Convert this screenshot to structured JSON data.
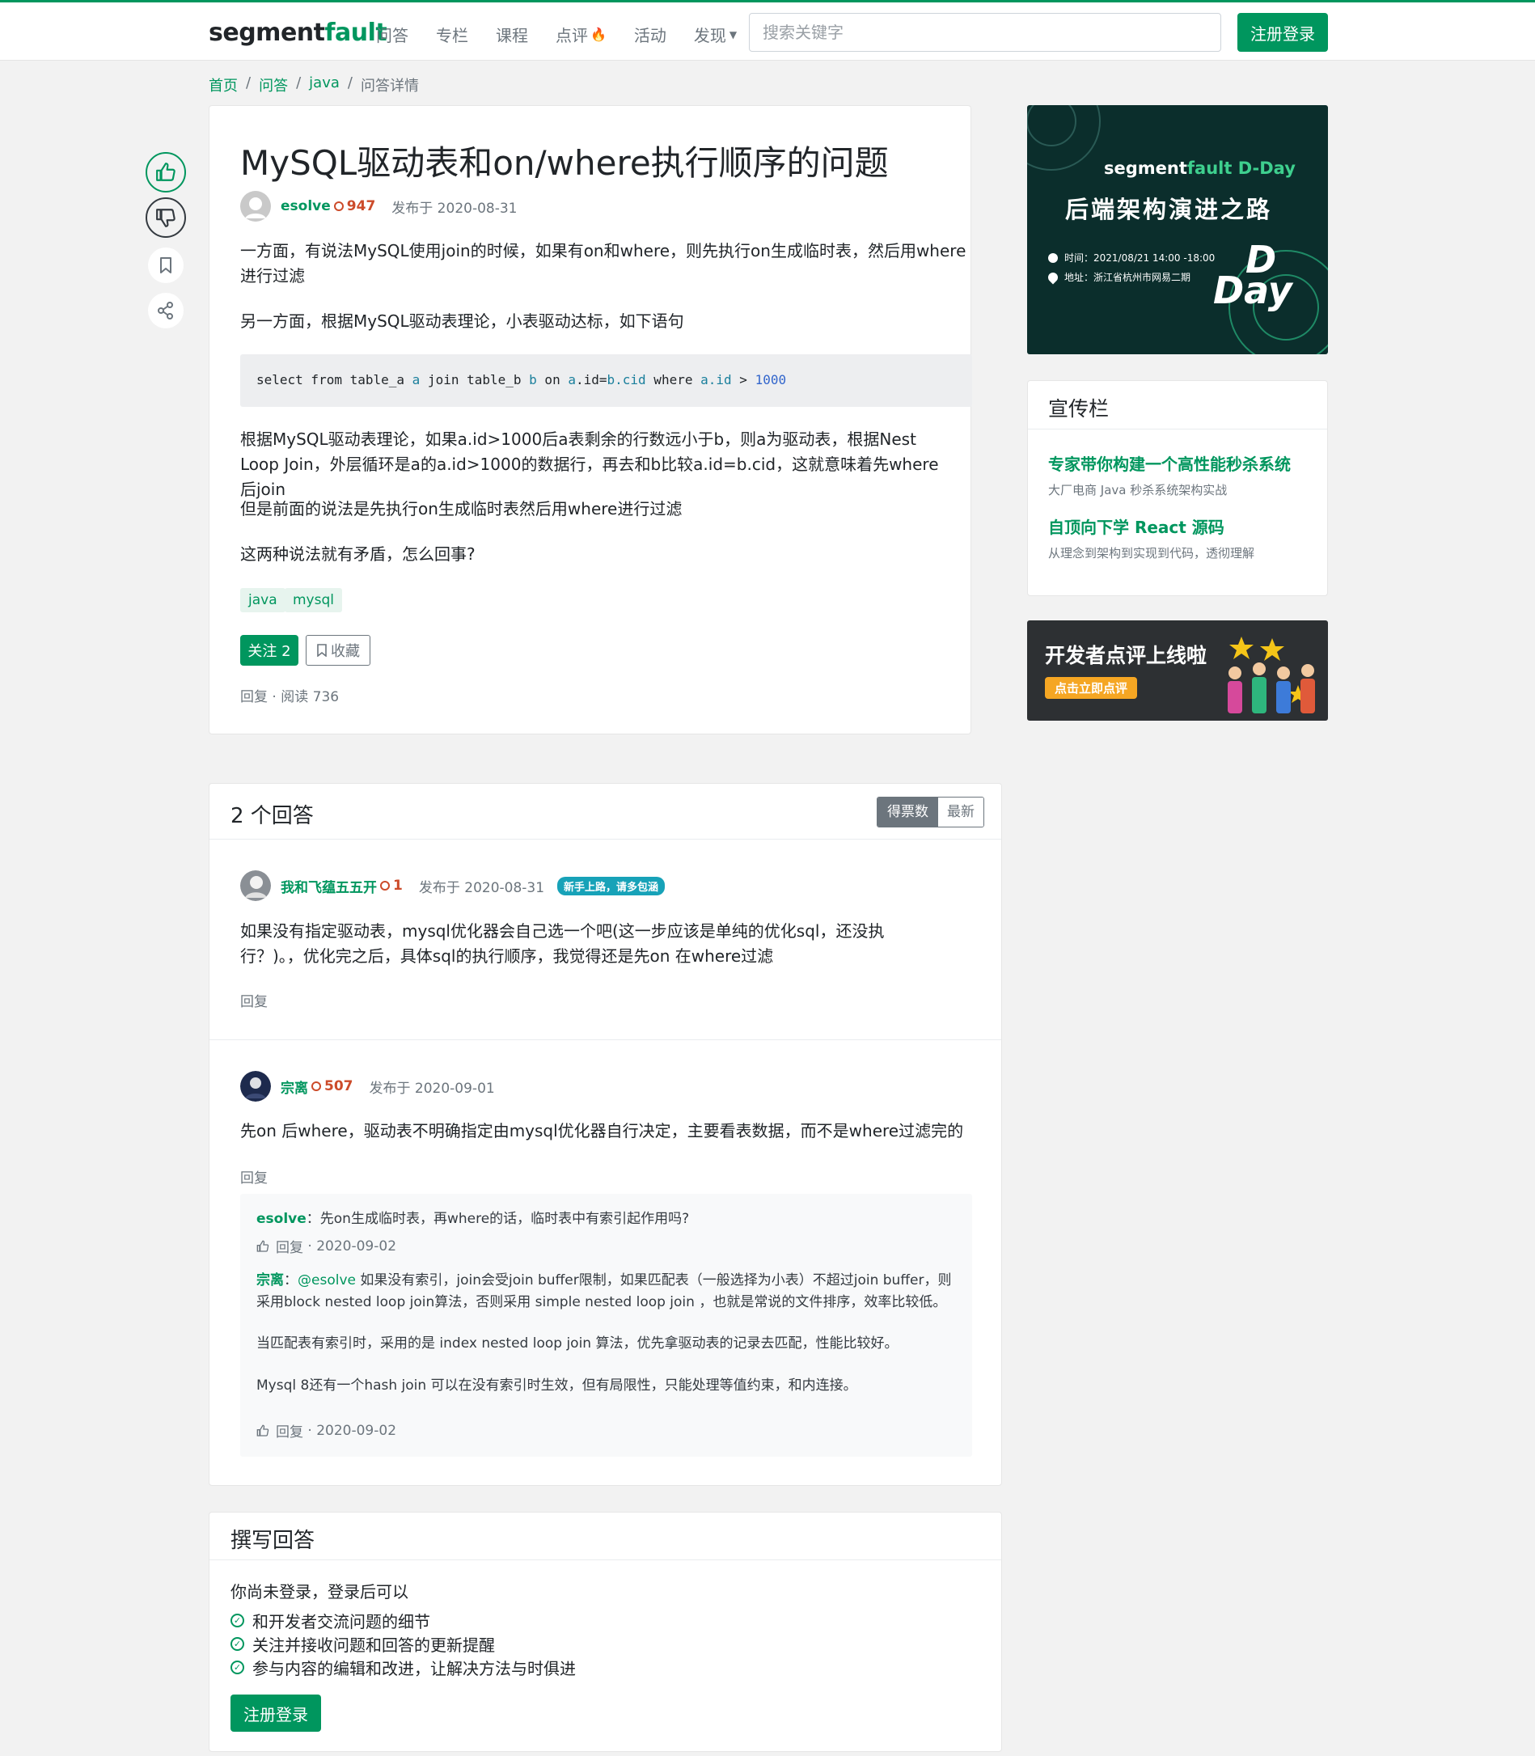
{
  "nav": {
    "logo_seg": "segment",
    "logo_fault": "fault",
    "links": [
      "问答",
      "专栏",
      "课程",
      "点评",
      "活动",
      "发现"
    ],
    "search_placeholder": "搜索关键字",
    "register_label": "注册登录"
  },
  "breadcrumb": {
    "home": "首页",
    "qa": "问答",
    "tag": "java",
    "current": "问答详情"
  },
  "question": {
    "title": "MySQL驱动表和on/where执行顺序的问题",
    "author": "esolve",
    "reputation": "947",
    "date": "发布于 2020-08-31",
    "p1": "一方面，有说法MySQL使用join的时候，如果有on和where，则先执行on生成临时表，然后用where进行过滤",
    "p2": "另一方面，根据MySQL驱动表理论，小表驱动达标，如下语句",
    "code": {
      "c1": "select from table_a ",
      "c2": "a",
      "c3": " join table_b ",
      "c4": "b",
      "c5": " on ",
      "c6": "a",
      "c7": ".id=",
      "c8": "b",
      "c9": ".cid",
      "c10": " where ",
      "c11": "a",
      "c12": ".id",
      "c13": " > ",
      "c14": "1000"
    },
    "p3": "根据MySQL驱动表理论，如果a.id>1000后a表剩余的行数远小于b，则a为驱动表，根据Nest Loop Join，外层循环是a的a.id>1000的数据行，再去和b比较a.id=b.cid，这就意味着先where后join",
    "p4": "但是前面的说法是先执行on生成临时表然后用where进行过滤",
    "p5": "这两种说法就有矛盾，怎么回事?",
    "tags": [
      "java",
      "mysql"
    ],
    "follow_label": "关注 2",
    "collect_label": "收藏",
    "footer_reply": "回复",
    "footer_read": "阅读 736"
  },
  "answers": {
    "heading": "2 个回答",
    "sort_votes": "得票数",
    "sort_latest": "最新",
    "list": [
      {
        "author": "我和飞蕴五五开",
        "reputation": "1",
        "date": "发布于 2020-08-31",
        "badge": "新手上路，请多包涵",
        "body": "如果没有指定驱动表，mysql优化器会自己选一个吧(这一步应该是单纯的优化sql，还没执行？)。，优化完之后，具体sql的执行顺序，我觉得还是先on 在where过滤",
        "reply": "回复"
      },
      {
        "author": "宗离",
        "reputation": "507",
        "date": "发布于 2020-09-01",
        "body": "先on 后where，驱动表不明确指定由mysql优化器自行决定，主要看表数据，而不是where过滤完的",
        "reply": "回复"
      }
    ],
    "comments": [
      {
        "user": "esolve",
        "text": "：先on生成临时表，再where的话，临时表中有索引起作用吗?",
        "reply": "回复",
        "date": "2020-09-02"
      },
      {
        "user": "宗离",
        "at": "@esolve",
        "text": " 如果没有索引，join会受join buffer限制，如果匹配表（一般选择为小表）不超过join buffer，则采用block nested loop join算法，否则采用 simple nested loop join ，也就是常说的文件排序，效率比较低。",
        "text2": "当匹配表有索引时，采用的是 index nested loop join 算法，优先拿驱动表的记录去匹配，性能比较好。",
        "text3": "Mysql 8还有一个hash join 可以在没有索引时生效，但有局限性，只能处理等值约束，和内连接。",
        "reply": "回复",
        "date": "2020-09-02"
      }
    ]
  },
  "write": {
    "title": "撰写回答",
    "intro": "你尚未登录，登录后可以",
    "items": [
      "和开发者交流问题的细节",
      "关注并接收问题和回答的更新提醒",
      "参与内容的编辑和改进，让解决方法与时俱进"
    ],
    "register_label": "注册登录"
  },
  "sidebar": {
    "banner1": {
      "brand_seg": "segment",
      "brand_fault": "fault",
      "brand_dday": " D-Day",
      "title": "后端架构演进之路",
      "time": "时间：2021/08/21 14:00 -18:00",
      "place": "地址：浙江省杭州市网易二期",
      "logo_d": "D",
      "logo_day": "Day"
    },
    "promo_title": "宣传栏",
    "promos": [
      {
        "title": "专家带你构建一个高性能秒杀系统",
        "sub": "大厂电商 Java 秒杀系统架构实战"
      },
      {
        "title": "自顶向下学 React 源码",
        "sub": "从理念到架构到实现到代码，透彻理解"
      }
    ],
    "banner2": {
      "title": "开发者点评上线啦",
      "button": "点击立即点评"
    }
  },
  "colors": {
    "brand": "#00965e",
    "reputation": "#cc4b2a",
    "badge": "#17a2b8"
  }
}
